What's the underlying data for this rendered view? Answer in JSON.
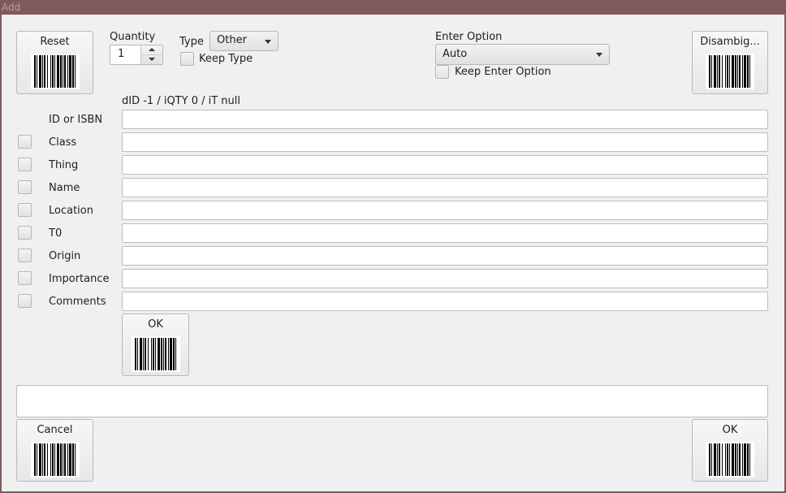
{
  "window": {
    "title": "Add"
  },
  "top": {
    "reset_label": "Reset",
    "quantity_label": "Quantity",
    "quantity_value": "1",
    "type_label": "Type",
    "type_value": "Other",
    "keep_type_label": "Keep Type",
    "enter_option_label": "Enter Option",
    "enter_option_value": "Auto",
    "keep_enter_option_label": "Keep Enter Option",
    "disambig_label": "Disambig..."
  },
  "debug_line": "dID -1 / iQTY 0 / iT null",
  "fields": {
    "id_label": "ID or ISBN",
    "class_label": "Class",
    "thing_label": "Thing",
    "name_label": "Name",
    "location_label": "Location",
    "t0_label": "T0",
    "origin_label": "Origin",
    "importance_label": "Importance",
    "comments_label": "Comments"
  },
  "ok_inner_label": "OK",
  "bottom": {
    "cancel_label": "Cancel",
    "ok_label": "OK"
  },
  "icons": {
    "barcode": "barcode-icon",
    "combo_arrow": "chevron-down-icon"
  },
  "colors": {
    "title_bar": "#7e5a5e",
    "panel": "#f0f0f0"
  }
}
